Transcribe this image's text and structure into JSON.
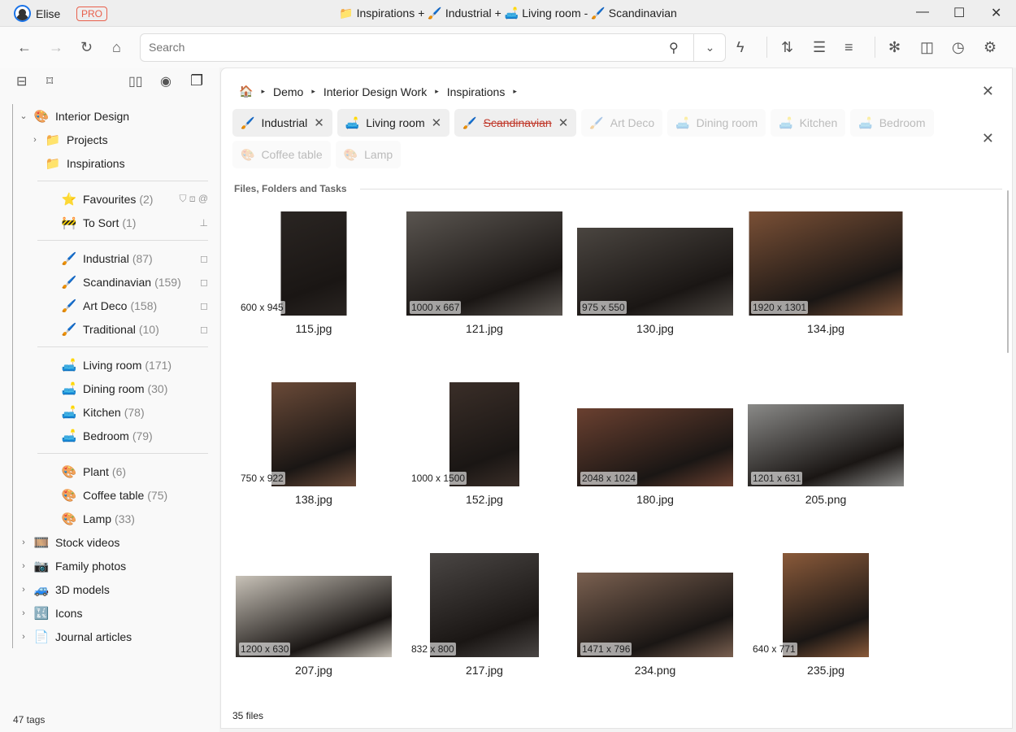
{
  "titlebar": {
    "user": "Elise",
    "badge": "PRO",
    "title_parts": [
      {
        "icon": "folder-icon",
        "glyph": "📁",
        "label": "Inspirations",
        "op": "+"
      },
      {
        "icon": "brush-icon",
        "glyph": "🖌️",
        "label": "Industrial",
        "op": "+"
      },
      {
        "icon": "sofa-icon",
        "glyph": "🛋️",
        "label": "Living room",
        "op": "-"
      },
      {
        "icon": "brush-icon",
        "glyph": "🖌️",
        "label": "Scandinavian",
        "op": ""
      }
    ]
  },
  "toolbar": {
    "search_placeholder": "Search"
  },
  "sidebar": {
    "root": {
      "label": "Interior Design",
      "icon": "palette-icon"
    },
    "folders": [
      {
        "label": "Projects",
        "expandable": true
      },
      {
        "label": "Inspirations",
        "expandable": false
      }
    ],
    "special": [
      {
        "label": "Favourites",
        "count": "(2)",
        "icon": "star-icon",
        "glyph": "⭐"
      },
      {
        "label": "To Sort",
        "count": "(1)",
        "icon": "barrier-icon",
        "glyph": "🚧"
      }
    ],
    "styles": [
      {
        "label": "Industrial",
        "count": "(87)"
      },
      {
        "label": "Scandinavian",
        "count": "(159)"
      },
      {
        "label": "Art Deco",
        "count": "(158)"
      },
      {
        "label": "Traditional",
        "count": "(10)"
      }
    ],
    "rooms": [
      {
        "label": "Living room",
        "count": "(171)"
      },
      {
        "label": "Dining room",
        "count": "(30)"
      },
      {
        "label": "Kitchen",
        "count": "(78)"
      },
      {
        "label": "Bedroom",
        "count": "(79)"
      }
    ],
    "objects": [
      {
        "label": "Plant",
        "count": "(6)"
      },
      {
        "label": "Coffee table",
        "count": "(75)"
      },
      {
        "label": "Lamp",
        "count": "(33)"
      }
    ],
    "others": [
      {
        "label": "Stock videos",
        "icon": "film-icon",
        "glyph": "🎞️"
      },
      {
        "label": "Family photos",
        "icon": "camera-icon",
        "glyph": "📷"
      },
      {
        "label": "3D models",
        "icon": "car-icon",
        "glyph": "🚙"
      },
      {
        "label": "Icons",
        "icon": "symbols-icon",
        "glyph": "🔣"
      },
      {
        "label": "Journal articles",
        "icon": "document-icon",
        "glyph": "📄"
      }
    ],
    "tag_count": "47 tags"
  },
  "main": {
    "breadcrumb": [
      "Demo",
      "Interior Design Work",
      "Inspirations"
    ],
    "chips": [
      {
        "label": "Industrial",
        "glyph": "🖌️",
        "state": "active"
      },
      {
        "label": "Living room",
        "glyph": "🛋️",
        "state": "active"
      },
      {
        "label": "Scandinavian",
        "glyph": "🖌️",
        "state": "excluded"
      },
      {
        "label": "Art Deco",
        "glyph": "🖌️",
        "state": "suggested"
      },
      {
        "label": "Dining room",
        "glyph": "🛋️",
        "state": "suggested"
      },
      {
        "label": "Kitchen",
        "glyph": "🛋️",
        "state": "suggested"
      },
      {
        "label": "Bedroom",
        "glyph": "🛋️",
        "state": "suggested"
      },
      {
        "label": "Coffee table",
        "glyph": "🎨",
        "state": "suggested"
      },
      {
        "label": "Lamp",
        "glyph": "🎨",
        "state": "suggested"
      }
    ],
    "section_title": "Files, Folders and Tasks",
    "files": [
      {
        "name": "115.jpg",
        "dims": "600 x 945",
        "color": "#2a2522"
      },
      {
        "name": "121.jpg",
        "dims": "1000 x 667",
        "color": "#5a5550"
      },
      {
        "name": "130.jpg",
        "dims": "975 x 550",
        "color": "#4a4540"
      },
      {
        "name": "134.jpg",
        "dims": "1920 x 1301",
        "color": "#7a5036"
      },
      {
        "name": "138.jpg",
        "dims": "750 x 922",
        "color": "#6a4a38"
      },
      {
        "name": "152.jpg",
        "dims": "1000 x 1500",
        "color": "#3a2e28"
      },
      {
        "name": "180.jpg",
        "dims": "2048 x 1024",
        "color": "#6a4030"
      },
      {
        "name": "205.png",
        "dims": "1201 x 631",
        "color": "#8a8a88"
      },
      {
        "name": "207.jpg",
        "dims": "1200 x 630",
        "color": "#c8c2b8"
      },
      {
        "name": "217.jpg",
        "dims": "832 x 800",
        "color": "#4a4644"
      },
      {
        "name": "234.png",
        "dims": "1471 x 796",
        "color": "#7a6050"
      },
      {
        "name": "235.jpg",
        "dims": "640 x 771",
        "color": "#8a5a3a"
      }
    ],
    "file_count": "35 files"
  }
}
